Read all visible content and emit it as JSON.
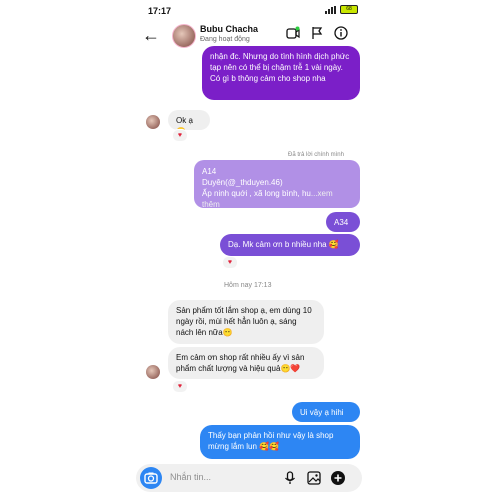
{
  "status_bar": {
    "time": "17:17",
    "battery": "68"
  },
  "header": {
    "name": "Bubu Chacha",
    "status": "Đang hoạt động"
  },
  "messages": {
    "sent_purple": "nhận đc. Nhưng do tình hình dịch phức tạp nên có thể bị chậm trễ 1 vài ngày. Có gì b thông cảm cho shop nha",
    "recv_ok": "Ok ạ😶",
    "reply_meta": "Đã trả lời chính mình",
    "reply_line1": "A14",
    "reply_line2": "Duyên(@_thduyen.46)",
    "reply_line3": "Ấp ninh quới , xã long bình, hu",
    "reply_more": "...xem thêm",
    "sent_a34": "A34",
    "sent_thanks": "Dạ. Mk cảm ơn b nhiều nha 🥰",
    "time_sep": "Hôm nay 17:13",
    "recv_review1": "Sản phẩm tốt lắm shop ạ, em dùng 10 ngày rồi, mùi hết hẳn luôn ạ, sáng nách lên nữa😶",
    "recv_review2": "Em cảm ơn shop rất nhiều ấy vì sản phẩm chất lượng và hiệu quả😶❤️",
    "sent_hihi": "Ui vậy ạ hihi",
    "sent_happy": "Thấy bạn phản hồi như vậy là shop mừng lắm lun 🥰🥰"
  },
  "reactions": {
    "heart": "♥"
  },
  "composer": {
    "placeholder": "Nhắn tin..."
  },
  "colors": {
    "purple": "#7b1fc8",
    "blue": "#2d86f3",
    "violet": "#7a4fd6",
    "gray": "#efefef"
  },
  "icons": [
    "back-arrow-icon",
    "video-call-icon",
    "flag-icon",
    "info-icon",
    "camera-icon",
    "microphone-icon",
    "image-icon",
    "plus-icon"
  ]
}
